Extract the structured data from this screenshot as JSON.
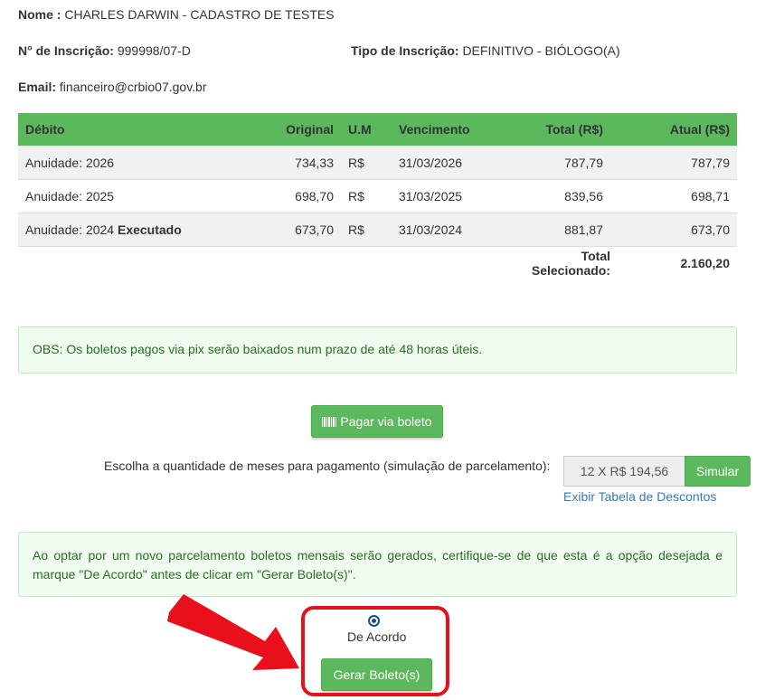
{
  "header": {
    "nome_label": "Nome :",
    "nome_value": "CHARLES DARWIN - CADASTRO DE TESTES",
    "inscricao_label": "N° de Inscrição:",
    "inscricao_value": "999998/07-D",
    "tipo_label": "Tipo de Inscrição:",
    "tipo_value": "DEFINITIVO - BIÓLOGO(A)",
    "email_label": "Email:",
    "email_value": "financeiro@crbio07.gov.br"
  },
  "table": {
    "columns": [
      "Débito",
      "Original",
      "U.M",
      "Vencimento",
      "Total (R$)",
      "Atual (R$)"
    ],
    "rows": [
      {
        "debito": "Anuidade: 2026",
        "status": "",
        "original": "734,33",
        "um": "R$",
        "vencimento": "31/03/2026",
        "total": "787,79",
        "atual": "787,79"
      },
      {
        "debito": "Anuidade: 2025",
        "status": "",
        "original": "698,70",
        "um": "R$",
        "vencimento": "31/03/2025",
        "total": "839,56",
        "atual": "698,71"
      },
      {
        "debito": "Anuidade: 2024",
        "status": "Executado",
        "original": "673,70",
        "um": "R$",
        "vencimento": "31/03/2024",
        "total": "881,87",
        "atual": "673,70"
      }
    ],
    "total_label": "Total Selecionado:",
    "total_value": "2.160,20"
  },
  "obs_text": "OBS: Os boletos pagos via pix serão baixados num prazo de até 48 horas úteis.",
  "pagar_button": "Pagar via boleto",
  "parcelamento": {
    "label": "Escolha a quantidade de meses para pagamento (simulação de parcelamento):",
    "selected": "12 X R$ 194,56",
    "simular_button": "Simular",
    "descontos_link": "Exibir Tabela de Descontos"
  },
  "warning_text": "Ao optar por um novo parcelamento boletos mensais serão gerados, certifique-se de que esta é a opção desejada e marque \"De Acordo\" antes de clicar em \"Gerar Boleto(s)\".",
  "acordo_label": "De Acordo",
  "gerar_button": "Gerar Boleto(s)",
  "colors": {
    "accent": "#5cb85c",
    "annotation": "#e8101b"
  }
}
